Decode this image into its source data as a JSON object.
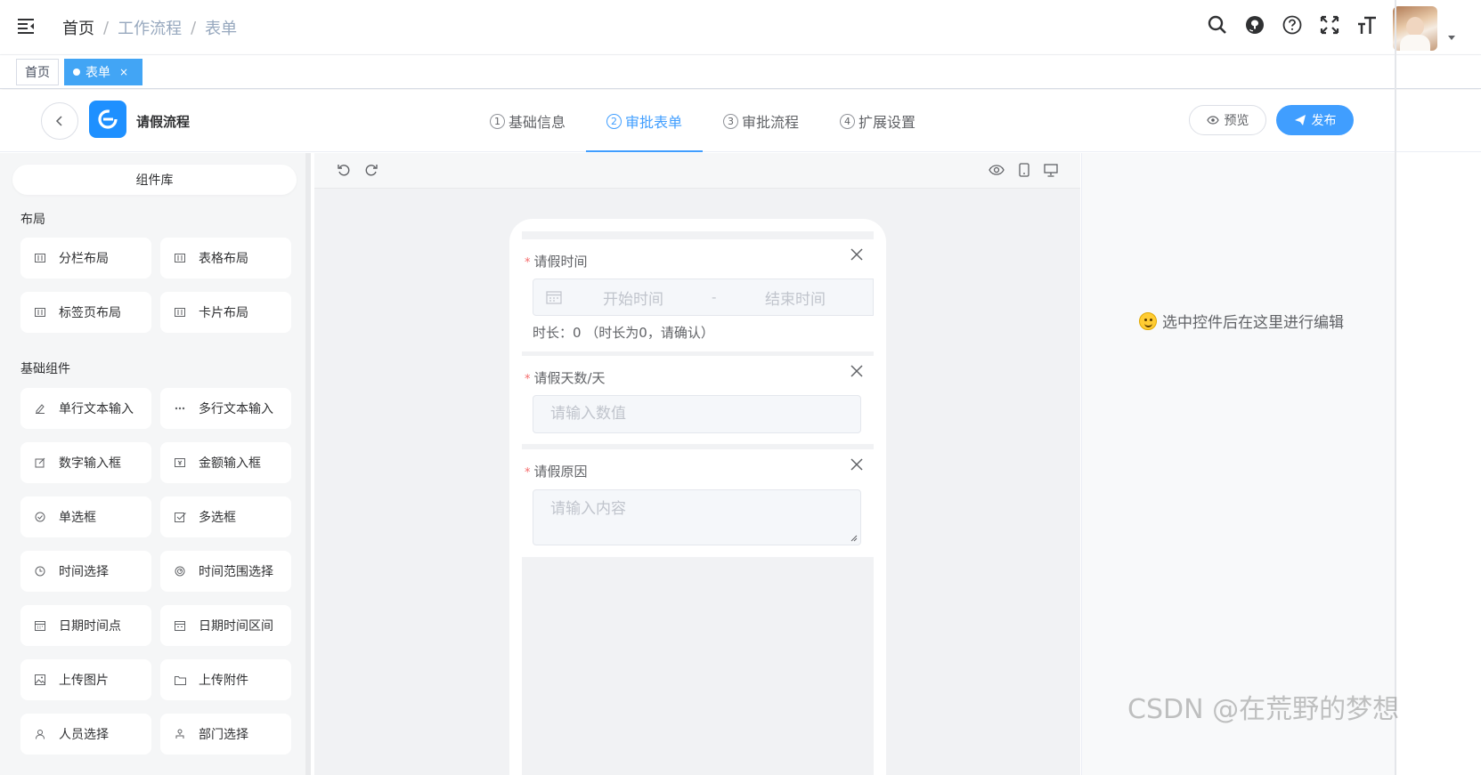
{
  "breadcrumb": [
    "首页",
    "工作流程",
    "表单"
  ],
  "tags": {
    "home": "首页",
    "active": "表单",
    "close": "×"
  },
  "designer": {
    "title": "请假流程",
    "steps": [
      {
        "num": "1",
        "label": "基础信息"
      },
      {
        "num": "2",
        "label": "审批表单"
      },
      {
        "num": "3",
        "label": "审批流程"
      },
      {
        "num": "4",
        "label": "扩展设置"
      }
    ],
    "active_step": 1,
    "preview": "预览",
    "publish": "发布"
  },
  "library": {
    "title": "组件库",
    "groups": [
      {
        "title": "布局",
        "items": [
          {
            "label": "分栏布局",
            "icon": "columns-icon"
          },
          {
            "label": "表格布局",
            "icon": "table-icon"
          },
          {
            "label": "标签页布局",
            "icon": "tabs-icon"
          },
          {
            "label": "卡片布局",
            "icon": "card-icon"
          }
        ]
      },
      {
        "title": "基础组件",
        "items": [
          {
            "label": "单行文本输入",
            "icon": "pen-icon"
          },
          {
            "label": "多行文本输入",
            "icon": "more-dots-icon"
          },
          {
            "label": "数字输入框",
            "icon": "edit-icon"
          },
          {
            "label": "金额输入框",
            "icon": "money-icon"
          },
          {
            "label": "单选框",
            "icon": "radio-icon"
          },
          {
            "label": "多选框",
            "icon": "checkbox-icon"
          },
          {
            "label": "时间选择",
            "icon": "clock-icon"
          },
          {
            "label": "时间范围选择",
            "icon": "timer-icon"
          },
          {
            "label": "日期时间点",
            "icon": "calendar-icon"
          },
          {
            "label": "日期时间区间",
            "icon": "date-range-icon"
          },
          {
            "label": "上传图片",
            "icon": "image-icon"
          },
          {
            "label": "上传附件",
            "icon": "folder-icon"
          },
          {
            "label": "人员选择",
            "icon": "user-icon"
          },
          {
            "label": "部门选择",
            "icon": "dept-icon"
          }
        ]
      }
    ]
  },
  "form": {
    "fields": [
      {
        "label": "请假时间",
        "required": "*",
        "start_placeholder": "开始时间",
        "separator": "-",
        "end_placeholder": "结束时间",
        "note": "时长：0 （时长为0，请确认）"
      },
      {
        "label": "请假天数/天",
        "required": "*",
        "placeholder": "请输入数值"
      },
      {
        "label": "请假原因",
        "required": "*",
        "placeholder": "请输入内容"
      }
    ]
  },
  "right_panel": {
    "hint": "选中控件后在这里进行编辑"
  },
  "watermark": "CSDN @在荒野的梦想",
  "colors": {
    "primary": "#409eff",
    "tag_active": "#42a5f5",
    "required": "#f56c6c"
  }
}
